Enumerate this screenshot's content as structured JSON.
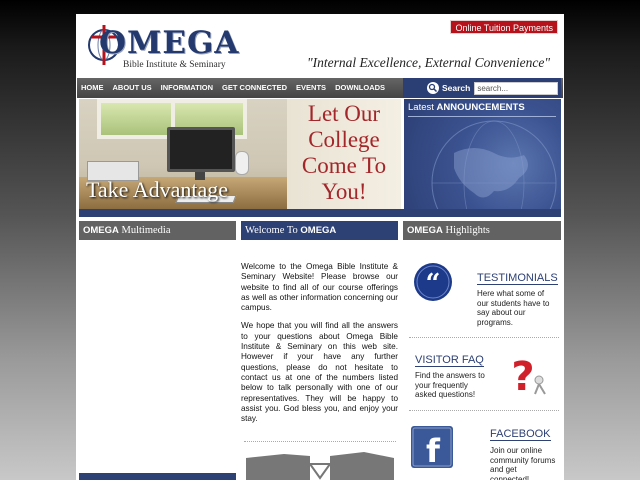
{
  "header": {
    "logo_text": "OMEGA",
    "logo_subtitle": "Bible Institute & Seminary",
    "tuition_button": "Online Tuition Payments",
    "tagline": "\"Internal Excellence, External Convenience\""
  },
  "nav": {
    "items": [
      {
        "label": "HOME"
      },
      {
        "label": "ABOUT US"
      },
      {
        "label": "INFORMATION"
      },
      {
        "label": "GET CONNECTED"
      },
      {
        "label": "EVENTS"
      },
      {
        "label": "DOWNLOADS"
      }
    ],
    "search_label": "Search",
    "search_value": "search..."
  },
  "banner": {
    "headline_lines": [
      "Let Our",
      "College",
      "Come To",
      "You!"
    ],
    "caption": "Take Advantage"
  },
  "announcements": {
    "prefix": "Latest",
    "title": "ANNOUNCEMENTS"
  },
  "columns": {
    "multimedia": {
      "brand": "OMEGA",
      "label": "Multimedia"
    },
    "welcome": {
      "prefix": "Welcome To",
      "brand": "OMEGA"
    },
    "highlights": {
      "brand": "OMEGA",
      "label": "Highlights"
    }
  },
  "welcome": {
    "paragraph1": "Welcome to the Omega Bible Institute & Seminary Website! Please browse our website to find all of our course offerings as well as other information concerning our campus.",
    "paragraph2": "We hope that you will find all the answers to your questions about Omega Bible Institute & Seminary on this web site. However if your have any further questions, please do not hesitate to contact us at one of the numbers listed below to talk personally with one of our representatives. They will be happy to assist you. God bless you, and enjoy your stay."
  },
  "highlights": {
    "testimonials": {
      "title": "TESTIMONIALS",
      "text": "Here what some of our students have to say about our programs."
    },
    "faq": {
      "title": "VISITOR FAQ",
      "text": "Find the answers to your frequently asked questions!"
    },
    "facebook": {
      "title": "FACEBOOK",
      "text": "Join our online community forums and get connected!"
    }
  },
  "colors": {
    "navy": "#2e4175",
    "nav_gray": "#555555",
    "tuition_red": "#b5121b",
    "banner_red": "#a3262a"
  }
}
